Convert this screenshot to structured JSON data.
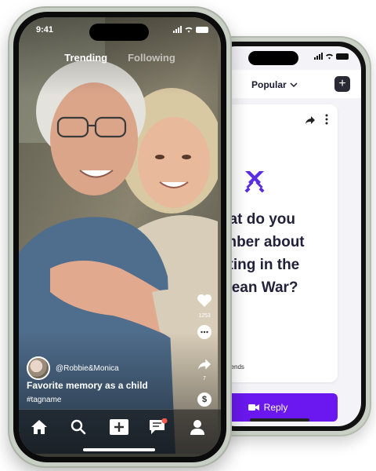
{
  "front_phone": {
    "status_time": "9:41",
    "tabs": [
      {
        "label": "Trending",
        "active": true
      },
      {
        "label": "Following",
        "active": false
      }
    ],
    "actions": {
      "like_count": "1253",
      "share_count": "7"
    },
    "post": {
      "author": "@Robbie&Monica",
      "caption": "Favorite memory as a child",
      "hashtag": "#tagname"
    },
    "nav": [
      "home-icon",
      "search-icon",
      "add-icon",
      "messages-icon",
      "profile-icon"
    ],
    "messages_badge": true
  },
  "back_phone": {
    "sort_label": "Popular",
    "question": {
      "line1": "What do you",
      "line2": "nember about",
      "line3": "ighting in the",
      "line4": "Korean War?"
    },
    "credit": "GrandFriends",
    "reply_label": "Reply"
  },
  "colors": {
    "accent": "#6a18ef",
    "accent_icon": "#5a2ee0",
    "badge": "#ff5a4e",
    "dark_text": "#23213a"
  }
}
